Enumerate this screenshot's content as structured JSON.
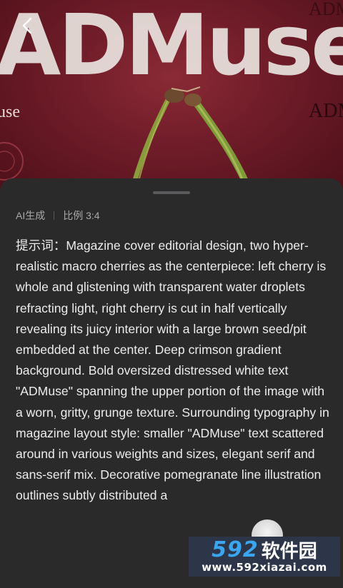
{
  "hero": {
    "big_title": "ADMuse",
    "small_text_top": "ADM",
    "small_text_right": "ADM",
    "small_text_left": "use"
  },
  "nav": {
    "back_icon": "chevron-left-icon"
  },
  "meta": {
    "source": "AI生成",
    "ratio": "比例 3:4"
  },
  "prompt": {
    "label": "提示词：",
    "text": "Magazine cover editorial design, two hyper-realistic macro cherries as the centerpiece: left cherry is whole and glistening with transparent water droplets refracting light, right cherry is cut in half vertically revealing its juicy interior with a large brown seed/pit embedded at the center. Deep crimson gradient background. Bold oversized distressed white text \"ADMuse\" spanning the upper portion of the image with a worn, gritty, grunge texture. Surrounding typography in magazine layout style: smaller \"ADMuse\" text scattered around in various weights and sizes, elegant serif and sans-serif mix. Decorative pomegranate line illustration outlines subtly distributed a"
  },
  "watermark": {
    "number": "592",
    "name": "软件园",
    "url": "www.592xiazai.com"
  },
  "colors": {
    "background_crimson": "#6e1c28",
    "sheet": "#2a2a2b",
    "text": "#ececec",
    "meta_text": "#a9a9ab",
    "watermark_blue": "#3aa6f0"
  }
}
